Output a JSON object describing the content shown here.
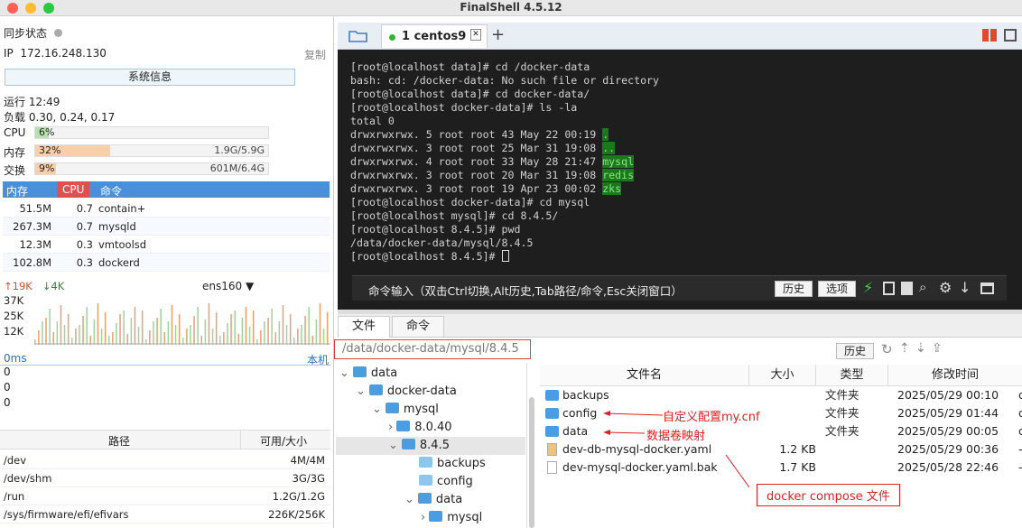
{
  "window": {
    "title": "FinalShell 4.5.12"
  },
  "sidebar": {
    "sync_label": "同步状态",
    "ip_label": "IP",
    "ip": "172.16.248.130",
    "copy": "复制",
    "sysinfo_button": "系统信息",
    "uptime": "运行 12:49",
    "load": "负载 0.30, 0.24, 0.17",
    "cpu": {
      "label": "CPU",
      "pct": "6%",
      "fraction": 0.06
    },
    "mem": {
      "label": "内存",
      "pct": "32%",
      "value": "1.9G/5.9G",
      "fraction": 0.32
    },
    "swap": {
      "label": "交换",
      "pct": "9%",
      "value": "601M/6.4G",
      "fraction": 0.09
    },
    "proc_headers": [
      "内存",
      "CPU",
      "命令"
    ],
    "procs": [
      {
        "mem": "51.5M",
        "cpu": "0.7",
        "cmd": "contain+"
      },
      {
        "mem": "267.3M",
        "cpu": "0.7",
        "cmd": "mysqld"
      },
      {
        "mem": "12.3M",
        "cpu": "0.3",
        "cmd": "vmtoolsd"
      },
      {
        "mem": "102.8M",
        "cpu": "0.3",
        "cmd": "dockerd"
      }
    ],
    "net": {
      "up": "↑19K",
      "down": "↓4K",
      "iface": "ens160",
      "y_ticks": [
        "37K",
        "25K",
        "12K"
      ]
    },
    "latency": {
      "label": "0ms",
      "host": "本机",
      "ticks": [
        "0",
        "0",
        "0"
      ]
    },
    "disk_headers": [
      "路径",
      "可用/大小"
    ],
    "disks": [
      {
        "path": "/dev",
        "size": "4M/4M"
      },
      {
        "path": "/dev/shm",
        "size": "3G/3G"
      },
      {
        "path": "/run",
        "size": "1.2G/1.2G"
      },
      {
        "path": "/sys/firmware/efi/efivars",
        "size": "226K/256K"
      }
    ]
  },
  "tabs": {
    "session": "1 centos9",
    "add": "+"
  },
  "terminal": {
    "lines": [
      "[root@localhost data]# cd /docker-data",
      "bash: cd: /docker-data: No such file or directory",
      "[root@localhost data]# cd docker-data/",
      "[root@localhost docker-data]# ls -la",
      "total 0",
      "drwxrwxrwx. 5 root root 43 May 22 00:19 ",
      "drwxrwxrwx. 3 root root 25 Mar 31 19:08 ",
      "drwxrwxrwx. 4 root root 33 May 28 21:47 ",
      "drwxrwxrwx. 3 root root 20 Mar 31 19:08 ",
      "drwxrwxrwx. 3 root root 19 Apr 23 00:02 ",
      "[root@localhost docker-data]# cd mysql",
      "[root@localhost mysql]# cd 8.4.5/",
      "[root@localhost 8.4.5]# pwd",
      "/data/docker-data/mysql/8.4.5",
      "[root@localhost 8.4.5]# "
    ],
    "hl": [
      ".",
      "..",
      "mysql",
      "redis",
      "zks"
    ],
    "cmd_hint": "命令输入（双击Ctrl切换,Alt历史,Tab路径/命令,Esc关闭窗口）",
    "history_btn": "历史",
    "options_btn": "选项"
  },
  "files": {
    "tab_files": "文件",
    "tab_cmds": "命令",
    "path": "/data/docker-data/mysql/8.4.5",
    "history_btn": "历史",
    "tree": [
      "data",
      "docker-data",
      "mysql",
      "8.0.40",
      "8.4.5",
      "backups",
      "config",
      "data",
      "mysql"
    ],
    "headers": [
      "文件名",
      "大小",
      "类型",
      "修改时间"
    ],
    "rows": [
      {
        "name": "backups",
        "size": "",
        "type": "文件夹",
        "time": "2025/05/29 00:10",
        "extra": "d"
      },
      {
        "name": "config",
        "size": "",
        "type": "文件夹",
        "time": "2025/05/29 01:44",
        "extra": "d"
      },
      {
        "name": "data",
        "size": "",
        "type": "文件夹",
        "time": "2025/05/29 00:05",
        "extra": "d"
      },
      {
        "name": "dev-db-mysql-docker.yaml",
        "size": "1.2 KB",
        "type": "",
        "time": "2025/05/29 00:36",
        "extra": "-"
      },
      {
        "name": "dev-mysql-docker.yaml.bak",
        "size": "1.7 KB",
        "type": "",
        "time": "2025/05/28 22:46",
        "extra": "-"
      }
    ],
    "annotations": {
      "config": "自定义配置my.cnf",
      "data": "数据卷映射",
      "compose": "docker compose 文件"
    }
  }
}
